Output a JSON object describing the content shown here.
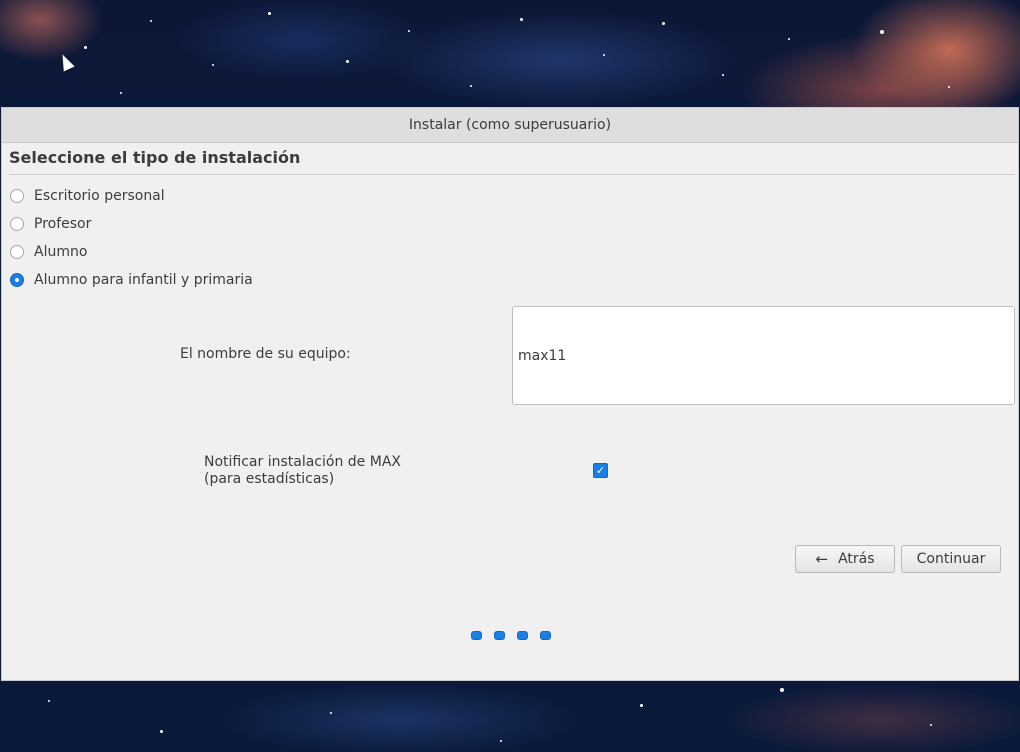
{
  "window": {
    "title": "Instalar (como superusuario)"
  },
  "install_type": {
    "heading": "Seleccione el tipo de instalación",
    "options": [
      {
        "label": "Escritorio personal",
        "checked": false
      },
      {
        "label": "Profesor",
        "checked": false
      },
      {
        "label": "Alumno",
        "checked": false
      },
      {
        "label": "Alumno para infantil y primaria",
        "checked": true
      }
    ]
  },
  "computer_name": {
    "label": "El nombre de su equipo:",
    "value": "max11"
  },
  "notify": {
    "label_line1": "Notificar instalación de MAX",
    "label_line2": "(para estadísticas)",
    "checked": true
  },
  "buttons": {
    "back_label": "Atrás",
    "continue_label": "Continuar"
  },
  "progress": {
    "steps_shown": 4,
    "accent_color": "#1a7fe4"
  }
}
